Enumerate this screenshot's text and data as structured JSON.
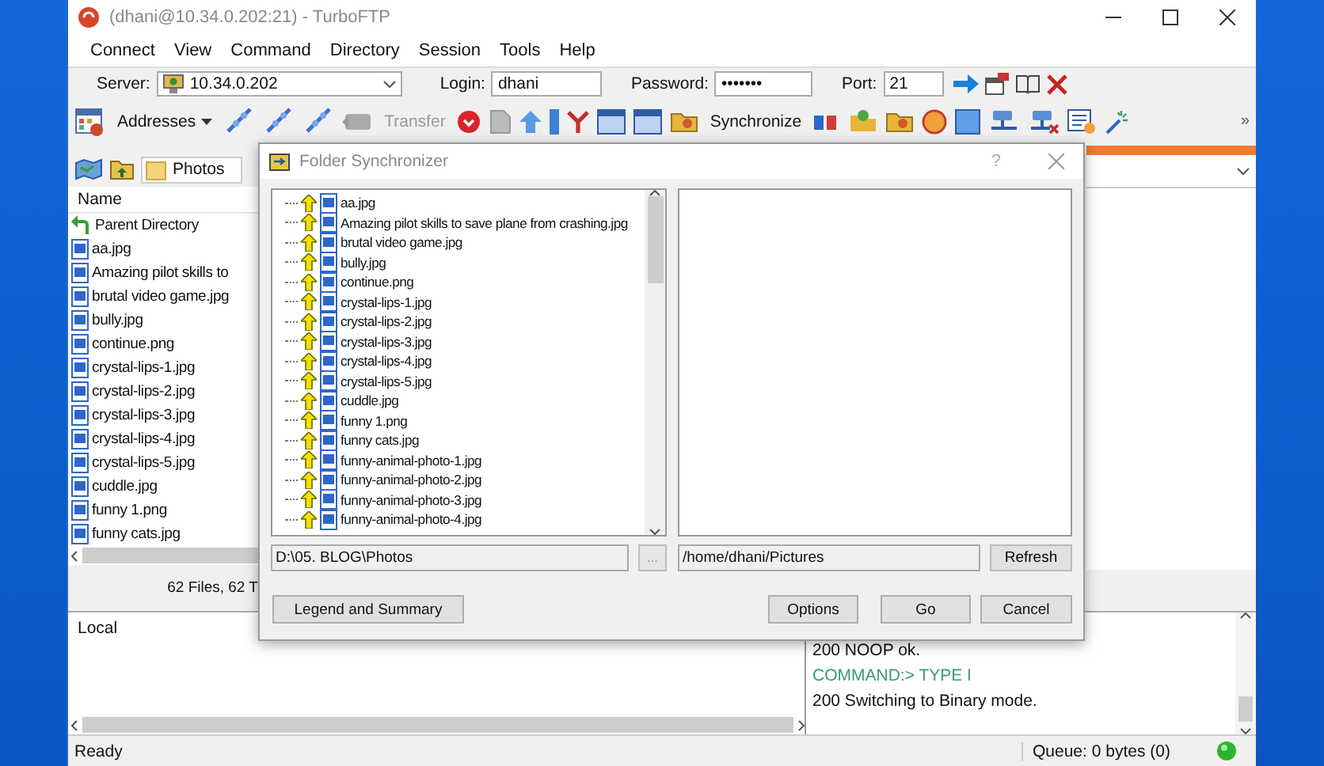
{
  "window": {
    "title": "(dhani@10.34.0.202:21) - TurboFTP"
  },
  "menu": [
    "Connect",
    "View",
    "Command",
    "Directory",
    "Session",
    "Tools",
    "Help"
  ],
  "connection": {
    "server_label": "Server:",
    "server": "10.34.0.202",
    "login_label": "Login:",
    "login": "dhani",
    "password_label": "Password:",
    "password": "•••••••",
    "port_label": "Port:",
    "port": "21"
  },
  "toolbar": [
    {
      "kind": "menu",
      "label": "Addresses",
      "disabled": false
    },
    {
      "kind": "button",
      "label": "Transfer",
      "disabled": true
    },
    {
      "kind": "button",
      "label": "Synchronize",
      "disabled": false
    }
  ],
  "toolbar_overflow": "»",
  "local_panel": {
    "folder_tab": "Photos",
    "column": "Name",
    "summary": "62 Files, 62 T",
    "files": [
      {
        "kind": "parent",
        "name": "Parent Directory"
      },
      {
        "kind": "image",
        "name": "aa.jpg"
      },
      {
        "kind": "image",
        "name": "Amazing pilot skills to"
      },
      {
        "kind": "image",
        "name": "brutal video game.jpg"
      },
      {
        "kind": "image",
        "name": "bully.jpg"
      },
      {
        "kind": "image",
        "name": "continue.png"
      },
      {
        "kind": "image",
        "name": "crystal-lips-1.jpg"
      },
      {
        "kind": "image",
        "name": "crystal-lips-2.jpg"
      },
      {
        "kind": "image",
        "name": "crystal-lips-3.jpg"
      },
      {
        "kind": "image",
        "name": "crystal-lips-4.jpg"
      },
      {
        "kind": "image",
        "name": "crystal-lips-5.jpg"
      },
      {
        "kind": "image",
        "name": "cuddle.jpg"
      },
      {
        "kind": "image",
        "name": "funny 1.png"
      },
      {
        "kind": "image",
        "name": "funny cats.jpg"
      }
    ]
  },
  "log": {
    "local_label": "Local",
    "lines": [
      {
        "kind": "response",
        "text": "200 NOOP ok."
      },
      {
        "kind": "command",
        "text": "COMMAND:> TYPE I"
      },
      {
        "kind": "response",
        "text": "200 Switching to Binary mode."
      }
    ]
  },
  "status_bar": {
    "text": "Ready",
    "queue": "Queue: 0 bytes (0)"
  },
  "dialog": {
    "title": "Folder Synchronizer",
    "help": "?",
    "local_files": [
      "aa.jpg",
      "Amazing pilot skills to save plane from crashing.jpg",
      "brutal video game.jpg",
      "bully.jpg",
      "continue.png",
      "crystal-lips-1.jpg",
      "crystal-lips-2.jpg",
      "crystal-lips-3.jpg",
      "crystal-lips-4.jpg",
      "crystal-lips-5.jpg",
      "cuddle.jpg",
      "funny 1.png",
      "funny cats.jpg",
      "funny-animal-photo-1.jpg",
      "funny-animal-photo-2.jpg",
      "funny-animal-photo-3.jpg",
      "funny-animal-photo-4.jpg"
    ],
    "local_path": "D:\\05. BLOG\\Photos",
    "browse": "...",
    "remote_path": "/home/dhani/Pictures",
    "refresh": "Refresh",
    "buttons": [
      {
        "kind": "legend",
        "label": "Legend and Summary"
      },
      {
        "kind": "options",
        "label": "Options"
      },
      {
        "kind": "go",
        "label": "Go"
      },
      {
        "kind": "cancel",
        "label": "Cancel"
      }
    ]
  }
}
